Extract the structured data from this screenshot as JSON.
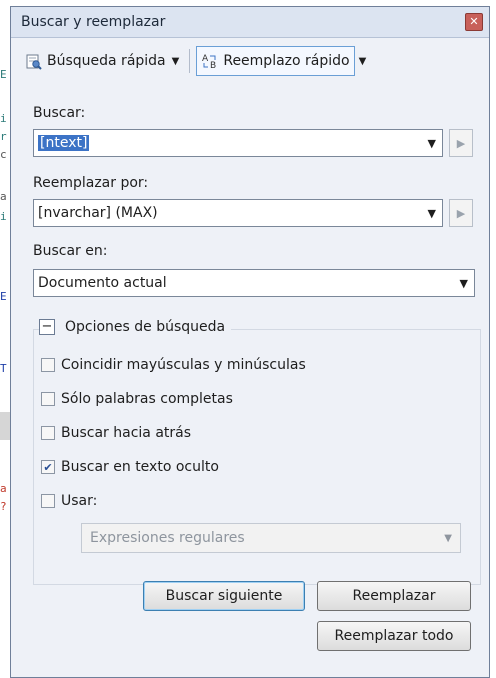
{
  "background": {
    "fragments": [
      "E",
      "i",
      "r",
      "c",
      "a",
      "i",
      "E",
      "T",
      "a",
      "?"
    ]
  },
  "dialog": {
    "title": "Buscar y reemplazar",
    "close_glyph": "✕",
    "toolbar": {
      "quick_find_label": "Búsqueda rápida",
      "quick_replace_label": "Reemplazo rápido"
    },
    "find": {
      "label": "Buscar:",
      "value": "[ntext]"
    },
    "replace": {
      "label": "Reemplazar por:",
      "value": "[nvarchar] (MAX)"
    },
    "look_in": {
      "label": "Buscar en:",
      "value": "Documento actual"
    },
    "options": {
      "header": "Opciones de búsqueda",
      "collapse_glyph": "−",
      "items": [
        {
          "label": "Coincidir mayúsculas y minúsculas",
          "checked": false
        },
        {
          "label": "Sólo palabras completas",
          "checked": false
        },
        {
          "label": "Buscar hacia atrás",
          "checked": false
        },
        {
          "label": "Buscar en texto oculto",
          "checked": true
        },
        {
          "label": "Usar:",
          "checked": false
        }
      ],
      "use_type": "Expresiones regulares"
    },
    "buttons": {
      "find_next": "Buscar siguiente",
      "replace": "Reemplazar",
      "replace_all": "Reemplazar todo"
    }
  },
  "colors": {
    "accent": "#3c73c6",
    "title_bar": "#dce4f1",
    "dialog_bg": "#eef1f7"
  }
}
